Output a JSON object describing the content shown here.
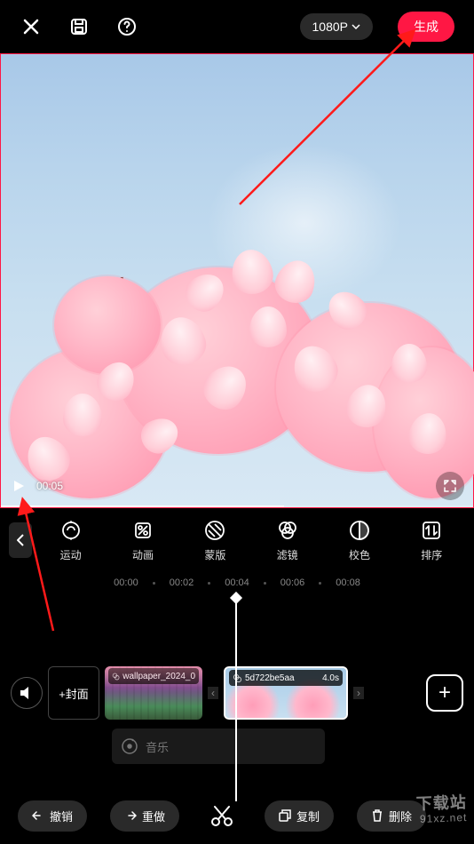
{
  "topbar": {
    "resolution_label": "1080P",
    "generate_label": "生成"
  },
  "preview": {
    "current_time": "00:05"
  },
  "tools": {
    "items": [
      {
        "label": "运动",
        "icon": "motion-icon"
      },
      {
        "label": "动画",
        "icon": "animation-icon"
      },
      {
        "label": "蒙版",
        "icon": "mask-icon"
      },
      {
        "label": "滤镜",
        "icon": "filter-icon"
      },
      {
        "label": "校色",
        "icon": "color-icon"
      },
      {
        "label": "排序",
        "icon": "sort-icon"
      }
    ]
  },
  "ruler": {
    "marks": [
      "00:00",
      "00:02",
      "00:04",
      "00:06",
      "00:08"
    ]
  },
  "timeline": {
    "cover_label": "+封面",
    "clip1_label": "wallpaper_2024_0",
    "clip2_label": "5d722be5aa",
    "clip2_duration": "4.0s",
    "music_label": "音乐",
    "add_label": "+"
  },
  "bottombar": {
    "undo_label": "撤销",
    "redo_label": "重做",
    "copy_label": "复制",
    "delete_label": "删除"
  },
  "watermark": {
    "line1": "下载站",
    "line2": "91xz.net"
  }
}
